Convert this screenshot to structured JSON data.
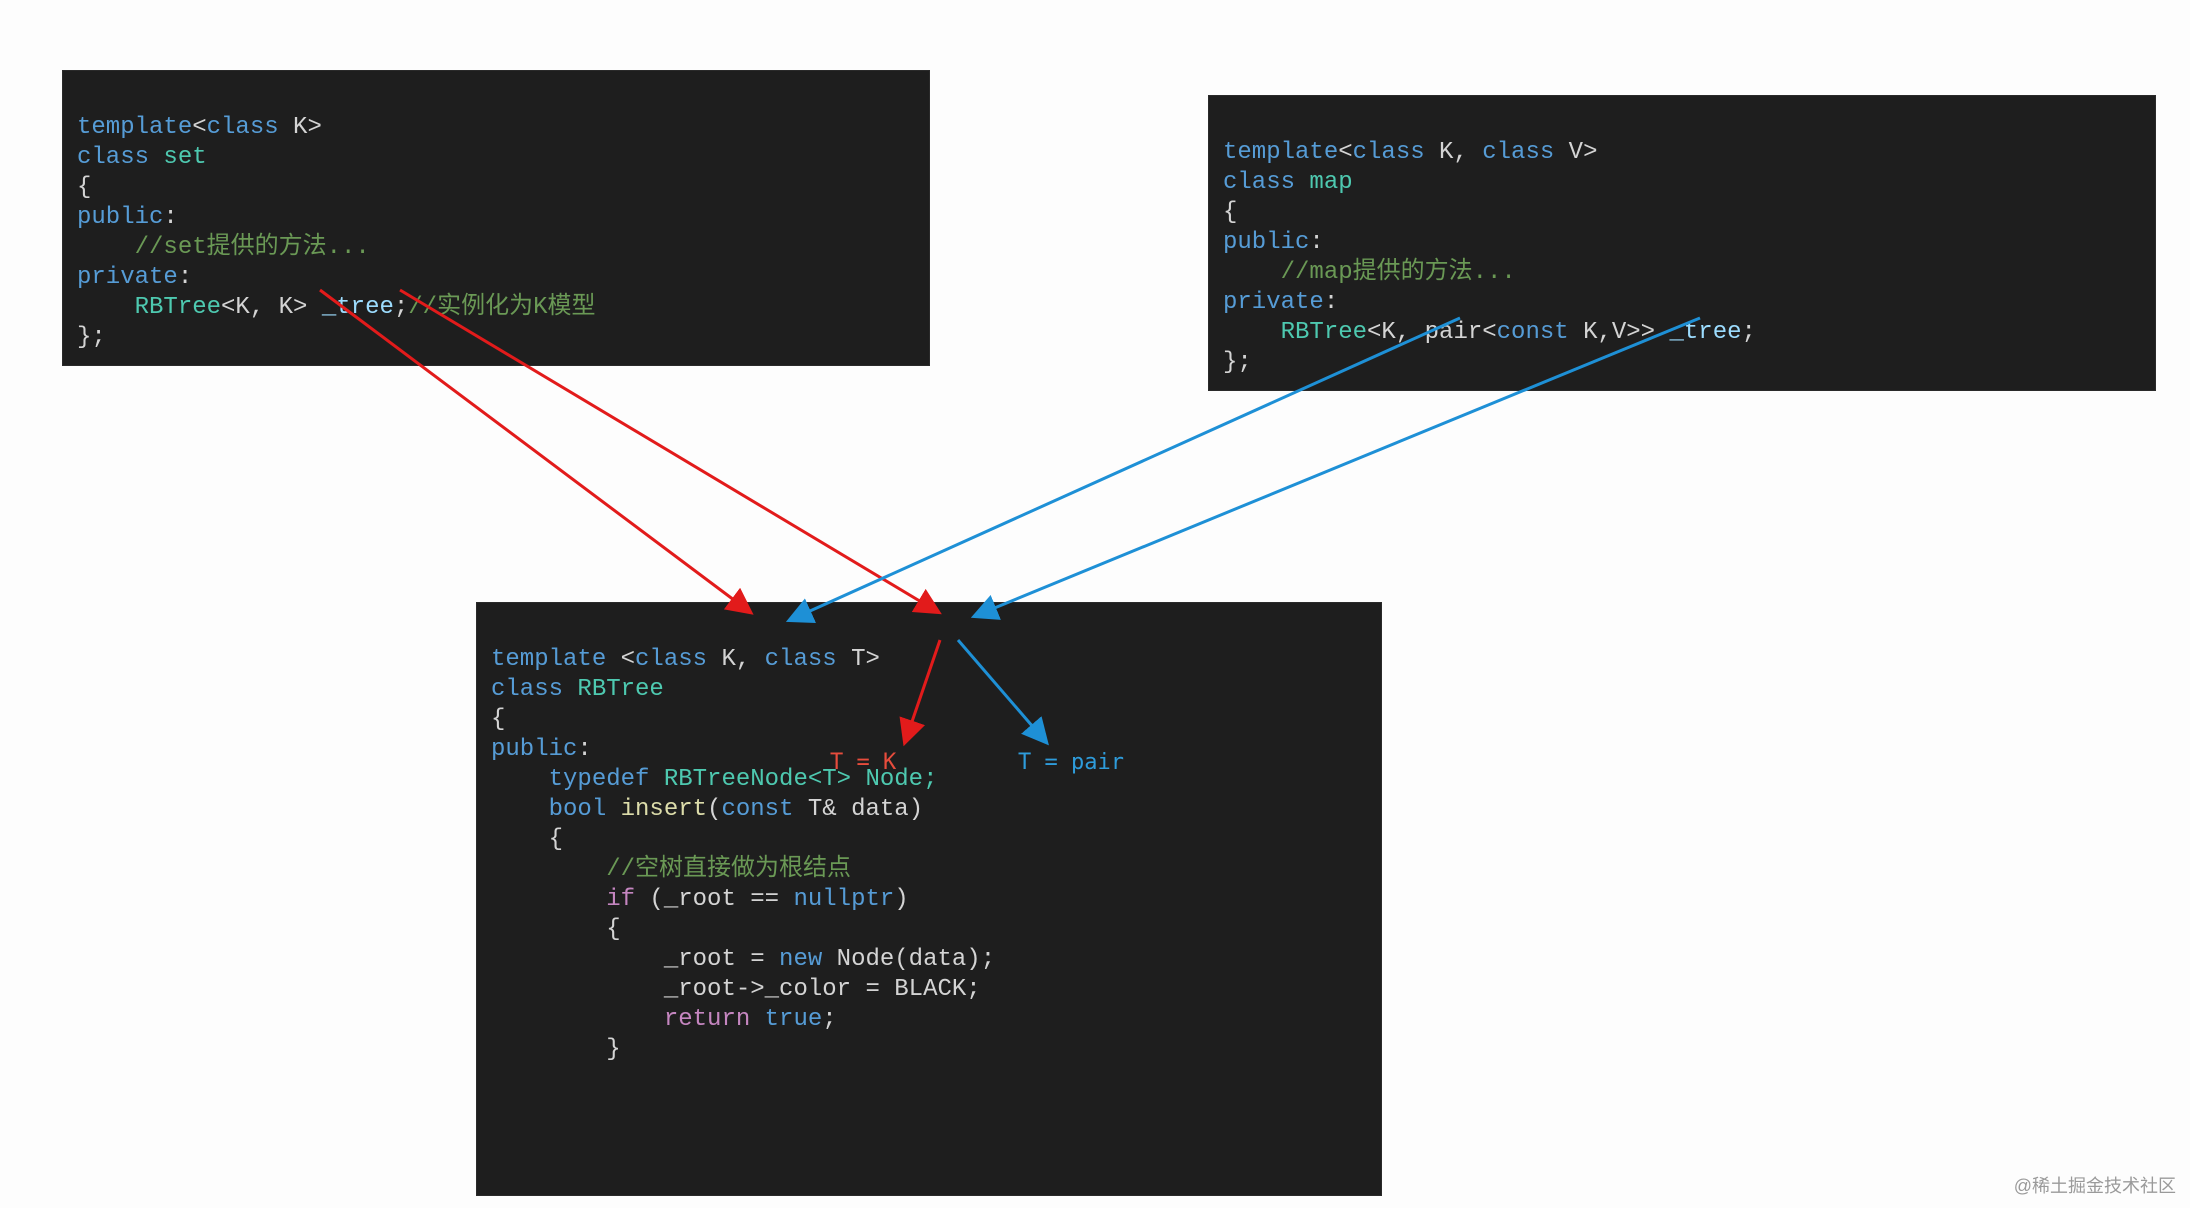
{
  "set_panel": {
    "l1_a": "template",
    "l1_b": "<",
    "l1_c": "class",
    "l1_d": " K>",
    "l2_a": "class",
    "l2_b": " set",
    "l3": "{",
    "l4_a": "public",
    "l4_b": ":",
    "l5": "    //set提供的方法...",
    "l6_a": "private",
    "l6_b": ":",
    "l7_a": "    RBTree",
    "l7_b": "<K, K> ",
    "l7_c": "_tree",
    "l7_d": ";",
    "l7_e": "//实例化为K模型",
    "l8": "};"
  },
  "map_panel": {
    "l1_a": "template",
    "l1_b": "<",
    "l1_c": "class",
    "l1_d": " K, ",
    "l1_e": "class",
    "l1_f": " V>",
    "l2_a": "class",
    "l2_b": " map",
    "l3": "{",
    "l4_a": "public",
    "l4_b": ":",
    "l5": "    //map提供的方法...",
    "l6_a": "private",
    "l6_b": ":",
    "l7_a": "    RBTree",
    "l7_b": "<K, pair<",
    "l7_c": "const",
    "l7_d": " K,V>> ",
    "l7_e": "_tree",
    "l7_f": ";",
    "l8": "};"
  },
  "rbtree_panel": {
    "l1_a": "template",
    "l1_b": " <",
    "l1_c": "class",
    "l1_d": " K, ",
    "l1_e": "class",
    "l1_f": " T>",
    "l2_a": "class",
    "l2_b": " RBTree",
    "l3": "{",
    "l4_a": "public",
    "l4_b": ":",
    "l5_a": "    typedef",
    "l5_b": " RBTreeNode<T> Node;",
    "l6_a": "    bool",
    "l6_b": " insert",
    "l6_c": "(",
    "l6_d": "const",
    "l6_e": " T& data)",
    "l7": "    {",
    "l8": "        //空树直接做为根结点",
    "l9_a": "        if",
    "l9_b": " (_root == ",
    "l9_c": "nullptr",
    "l9_d": ")",
    "l10": "        {",
    "l11_a": "            _root = ",
    "l11_b": "new",
    "l11_c": " Node(data);",
    "l12": "            _root->_color = BLACK;",
    "l13_a": "            return",
    "l13_b": " ",
    "l13_c": "true",
    "l13_d": ";",
    "l14": "        }"
  },
  "annotations": {
    "t_eq_k": "T = K",
    "t_eq_pair": "T = pair"
  },
  "watermark": "@稀土掘金技术社区"
}
